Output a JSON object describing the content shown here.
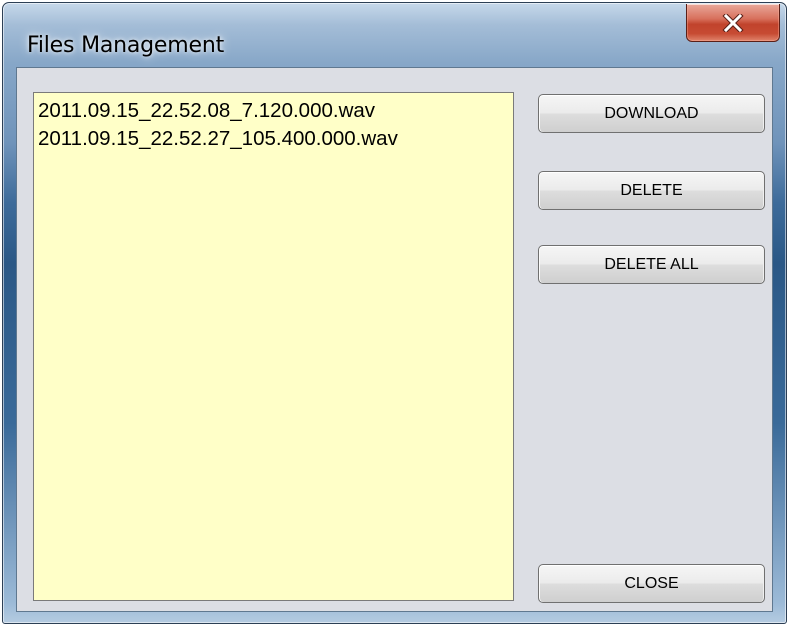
{
  "window": {
    "title": "Files Management",
    "close_icon": "close-icon"
  },
  "file_list": {
    "items": [
      "2011.09.15_22.52.08_7.120.000.wav",
      "2011.09.15_22.52.27_105.400.000.wav"
    ],
    "background_color": "#ffffc8"
  },
  "buttons": {
    "download": "DOWNLOAD",
    "delete": "DELETE",
    "delete_all": "DELETE ALL",
    "close": "CLOSE"
  },
  "colors": {
    "close_button": "#c1432c",
    "client_background": "#dcdee4"
  }
}
